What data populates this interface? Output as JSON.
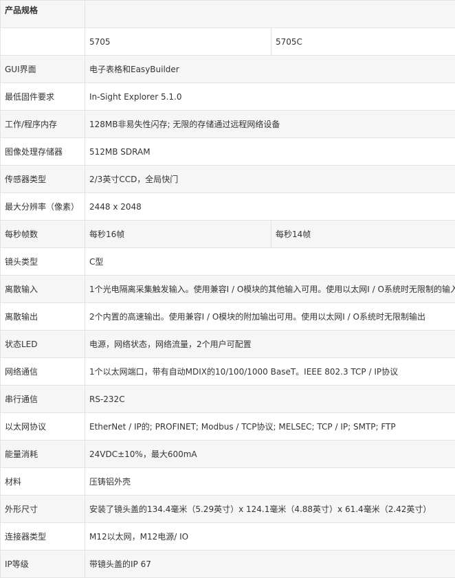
{
  "title": "产品规格",
  "models": [
    "5705",
    "5705C"
  ],
  "rows": [
    {
      "label": "GUI界面",
      "value": "电子表格和EasyBuilder"
    },
    {
      "label": "最低固件要求",
      "value": "In-Sight Explorer 5.1.0"
    },
    {
      "label": "工作/程序内存",
      "value": "128MB非易失性闪存; 无限的存储通过远程网络设备"
    },
    {
      "label": "图像处理存储器",
      "value": "512MB SDRAM"
    },
    {
      "label": "传感器类型",
      "value": "2/3英寸CCD，全局快门"
    },
    {
      "label": "最大分辨率（像素）",
      "value": "2448 x 2048"
    },
    {
      "label": "每秒帧数",
      "values": [
        "每秒16帧",
        "每秒14帧"
      ]
    },
    {
      "label": "镜头类型",
      "value": "C型"
    },
    {
      "label": "离散输入",
      "value": "1个光电隔离采集触发输入。使用兼容I / O模块的其他输入可用。使用以太网I / O系统时无限制的输入"
    },
    {
      "label": "离散输出",
      "value": "2个内置的高速输出。使用兼容I / O模块的附加输出可用。使用以太网I / O系统时无限制输出"
    },
    {
      "label": "状态LED",
      "value": "电源，网络状态，网络流量，2个用户可配置"
    },
    {
      "label": "网络通信",
      "value": "1个以太网端口，带有自动MDIX的10/100/1000 BaseT。IEEE 802.3 TCP / IP协议"
    },
    {
      "label": "串行通信",
      "value": "RS-232C"
    },
    {
      "label": "以太网协议",
      "value": "EtherNet / IP的; PROFINET; Modbus / TCP协议; MELSEC; TCP / IP; SMTP; FTP"
    },
    {
      "label": "能量消耗",
      "value": "24VDC±10%，最大600mA"
    },
    {
      "label": "材料",
      "value": "压铸铝外壳"
    },
    {
      "label": "外形尺寸",
      "value": "安装了镜头盖的134.4毫米（5.29英寸）x 124.1毫米（4.88英寸）x 61.4毫米（2.42英寸）"
    },
    {
      "label": "连接器类型",
      "value": "M12以太网，M12电源/ IO"
    },
    {
      "label": "IP等级",
      "value": "带镜头盖的IP 67"
    }
  ]
}
